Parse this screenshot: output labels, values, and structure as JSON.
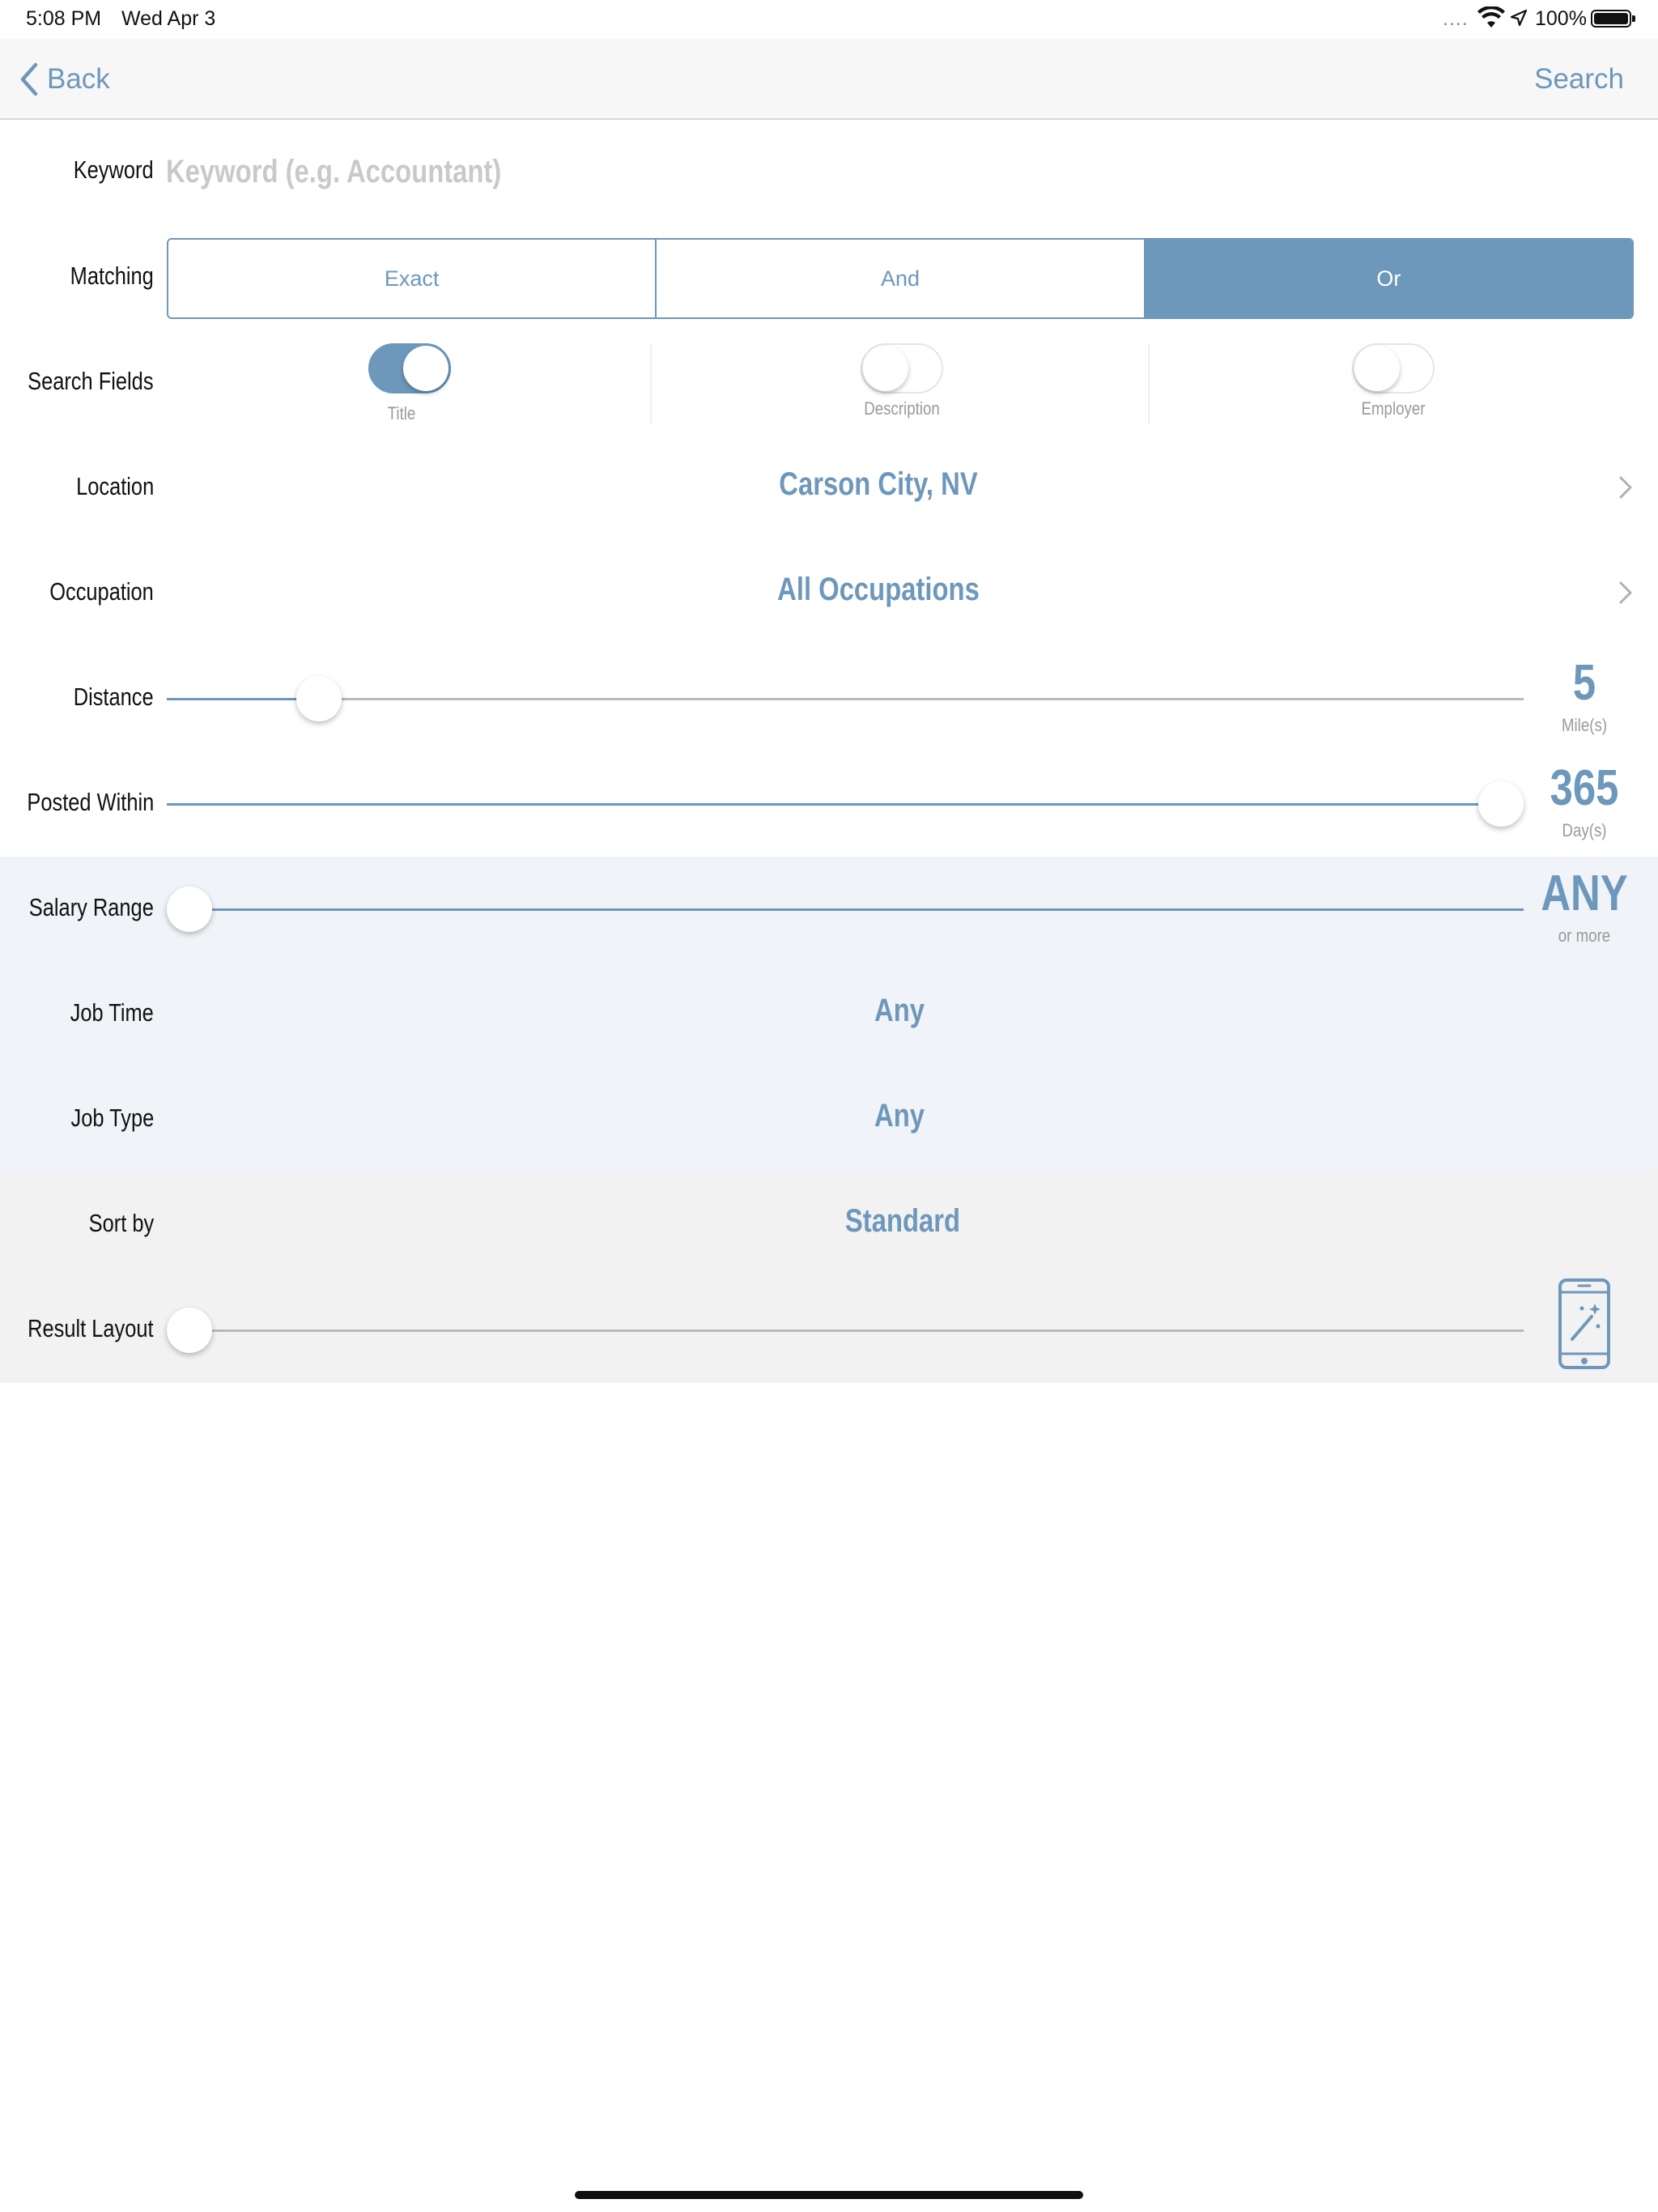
{
  "status_bar": {
    "time": "5:08 PM",
    "date": "Wed Apr 3",
    "signal_dots": "....",
    "battery": "100%",
    "icons": [
      "wifi-icon",
      "location-arrow-icon",
      "battery-icon"
    ]
  },
  "nav": {
    "back_label": "Back",
    "search_label": "Search"
  },
  "form": {
    "keyword": {
      "label": "Keyword",
      "value": "",
      "placeholder": "Keyword (e.g. Accountant)"
    },
    "matching": {
      "label": "Matching",
      "options": [
        "Exact",
        "And",
        "Or"
      ],
      "selected": "Or"
    },
    "search_fields": {
      "label": "Search Fields",
      "toggles": [
        {
          "label": "Title",
          "on": true
        },
        {
          "label": "Description",
          "on": false
        },
        {
          "label": "Employer",
          "on": false
        }
      ]
    },
    "location": {
      "label": "Location",
      "value": "Carson City, NV"
    },
    "occupation": {
      "label": "Occupation",
      "value": "All Occupations"
    },
    "distance": {
      "label": "Distance",
      "value": "5",
      "unit": "Mile(s)",
      "position_fraction": 0.11
    },
    "posted_within": {
      "label": "Posted Within",
      "value": "365",
      "unit": "Day(s)",
      "position_fraction": 0.98
    },
    "salary_range": {
      "label": "Salary Range",
      "value": "ANY",
      "unit": "or more",
      "position_fraction": 0.0
    },
    "job_time": {
      "label": "Job Time",
      "value": "Any"
    },
    "job_type": {
      "label": "Job Type",
      "value": "Any"
    },
    "sort_by": {
      "label": "Sort by",
      "value": "Standard"
    },
    "result_layout": {
      "label": "Result Layout",
      "position_fraction": 0.0,
      "icon": "phone-magic-wand-icon"
    }
  },
  "colors": {
    "accent": "#6d97bb",
    "label_text": "#111111",
    "muted_text": "#9a9a9a",
    "placeholder": "#c9c9c9",
    "shade_blue": "#f0f3f7",
    "shade_grey": "#f2f2f2"
  }
}
